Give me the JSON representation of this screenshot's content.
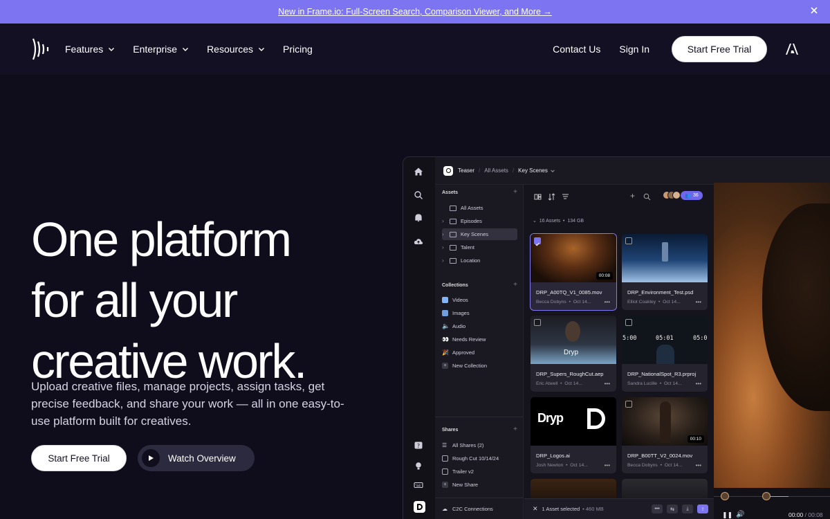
{
  "announcement": {
    "text": "New in Frame.io: Full-Screen Search, Comparison Viewer, and More →"
  },
  "nav": {
    "items": [
      {
        "label": "Features",
        "dropdown": true
      },
      {
        "label": "Enterprise",
        "dropdown": true
      },
      {
        "label": "Resources",
        "dropdown": true
      },
      {
        "label": "Pricing",
        "dropdown": false
      }
    ],
    "contact": "Contact Us",
    "signin": "Sign In",
    "trial": "Start Free Trial"
  },
  "hero": {
    "title_lines": [
      "One platform",
      "for all your",
      "creative work."
    ],
    "subtitle": "Upload creative files, manage projects, assign tasks, get precise feedback, and share your work — all in one easy-to-use platform built for creatives.",
    "cta_primary": "Start Free Trial",
    "cta_secondary": "Watch Overview"
  },
  "app": {
    "breadcrumb": {
      "project": "Teaser",
      "parent": "All Assets",
      "current": "Key Scenes"
    },
    "assets_section": "Assets",
    "assets_items": [
      "All Assets",
      "Episodes",
      "Key Scenes",
      "Talent",
      "Location"
    ],
    "collections_section": "Collections",
    "collections_items": [
      "Videos",
      "Images",
      "Audio",
      "Needs Review",
      "Approved",
      "New Collection"
    ],
    "shares_section": "Shares",
    "shares_items": [
      "All Shares (2)",
      "Rough Cut 10/14/24",
      "Trailer v2",
      "New Share"
    ],
    "c2c": "C2C Connections",
    "members_count": "36",
    "assets_summary": "16 Assets",
    "assets_size": "134 GB",
    "cards": [
      {
        "name": "DRP_A00TQ_V1_0085.mov",
        "owner": "Becca Dobyns",
        "date": "Oct 14...",
        "duration": "00:08",
        "selected": true
      },
      {
        "name": "DRP_Environment_Test.psd",
        "owner": "Elliot Coakley",
        "date": "Oct 14...",
        "duration": "",
        "selected": false
      },
      {
        "name": "DRP_Supers_RoughCut.aep",
        "owner": "Eric Atwell",
        "date": "Oct 14...",
        "duration": "",
        "selected": false
      },
      {
        "name": "DRP_NationalSpot_R3.prproj",
        "owner": "Sandra Lucille",
        "date": "Oct 14...",
        "duration": "",
        "selected": false
      },
      {
        "name": "DRP_Logos.ai",
        "owner": "Josh Newton",
        "date": "Oct 14...",
        "duration": "",
        "selected": false
      },
      {
        "name": "DRP_B00TT_V2_0024.mov",
        "owner": "Becca Dobyns",
        "date": "Oct 14...",
        "duration": "00:10",
        "selected": false
      }
    ],
    "thumb_text": {
      "brand": "Dryp",
      "timecodes": [
        "5:00",
        "05:01",
        "05:0"
      ]
    },
    "selection": "1 Asset selected",
    "selection_size": "460 MB",
    "player_time": "00:00",
    "player_total": "/ 00:08"
  },
  "colors": {
    "accent": "#7d74f2",
    "bg": "#0f0c1c",
    "nav_bg": "#131024"
  }
}
